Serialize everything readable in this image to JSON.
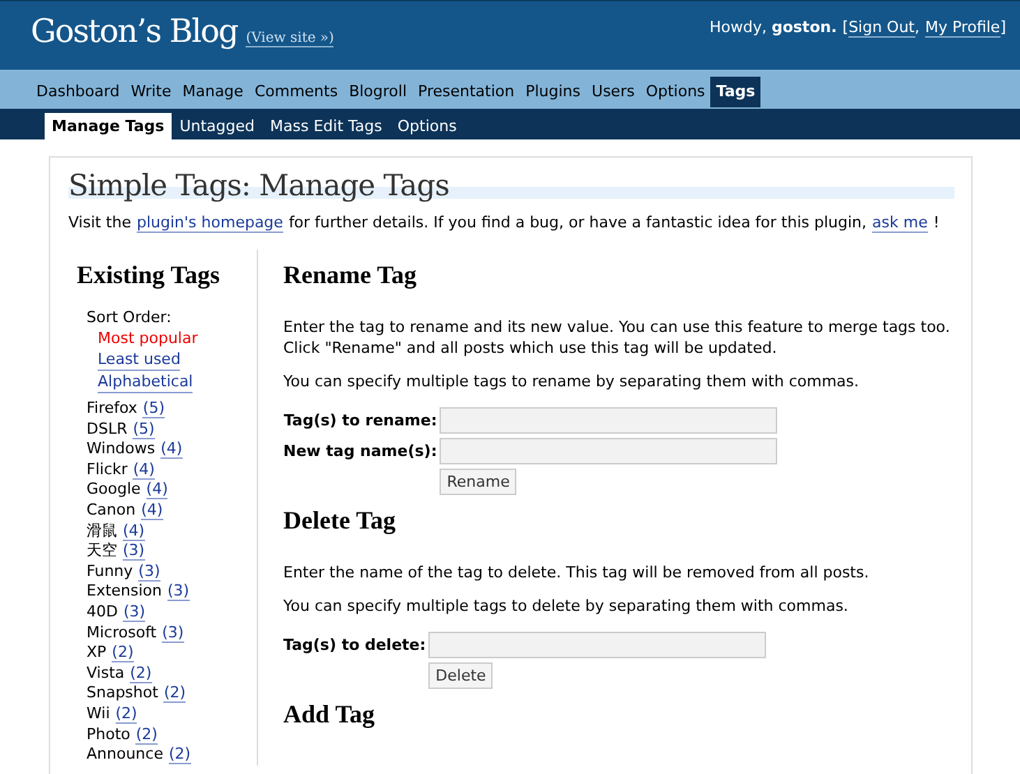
{
  "header": {
    "blog_title": "Goston’s Blog",
    "view_site": "(View site »)",
    "greeting": "Howdy,",
    "user": "goston.",
    "open_bracket": "[",
    "sign_out": "Sign Out",
    "separator": ",",
    "profile": "My Profile",
    "close_bracket": "]"
  },
  "nav": [
    {
      "label": "Dashboard",
      "selected": false
    },
    {
      "label": "Write",
      "selected": false
    },
    {
      "label": "Manage",
      "selected": false
    },
    {
      "label": "Comments",
      "selected": false
    },
    {
      "label": "Blogroll",
      "selected": false
    },
    {
      "label": "Presentation",
      "selected": false
    },
    {
      "label": "Plugins",
      "selected": false
    },
    {
      "label": "Users",
      "selected": false
    },
    {
      "label": "Options",
      "selected": false
    },
    {
      "label": "Tags",
      "selected": true
    }
  ],
  "subnav": [
    {
      "label": "Manage Tags",
      "selected": true
    },
    {
      "label": "Untagged",
      "selected": false
    },
    {
      "label": "Mass Edit Tags",
      "selected": false
    },
    {
      "label": "Options",
      "selected": false
    }
  ],
  "page_title": "Simple Tags: Manage Tags",
  "intro": {
    "before": "Visit the",
    "link1": "plugin's homepage",
    "middle": "for further details. If you find a bug, or have a fantastic idea for this plugin,",
    "link2": "ask me",
    "after": "!"
  },
  "existing_tags": {
    "title": "Existing Tags",
    "sort_label": "Sort Order:",
    "sort_options": [
      {
        "label": "Most popular",
        "selected": true
      },
      {
        "label": "Least used",
        "selected": false
      },
      {
        "label": "Alphabetical",
        "selected": false
      }
    ],
    "tags": [
      {
        "name": "Firefox",
        "count": "(5)"
      },
      {
        "name": "DSLR",
        "count": "(5)"
      },
      {
        "name": "Windows",
        "count": "(4)"
      },
      {
        "name": "Flickr",
        "count": "(4)"
      },
      {
        "name": "Google",
        "count": "(4)"
      },
      {
        "name": "Canon",
        "count": "(4)"
      },
      {
        "name": "滑鼠",
        "count": "(4)"
      },
      {
        "name": "天空",
        "count": "(3)"
      },
      {
        "name": "Funny",
        "count": "(3)"
      },
      {
        "name": "Extension",
        "count": "(3)"
      },
      {
        "name": "40D",
        "count": "(3)"
      },
      {
        "name": "Microsoft",
        "count": "(3)"
      },
      {
        "name": "XP",
        "count": "(2)"
      },
      {
        "name": "Vista",
        "count": "(2)"
      },
      {
        "name": "Snapshot",
        "count": "(2)"
      },
      {
        "name": "Wii",
        "count": "(2)"
      },
      {
        "name": "Photo",
        "count": "(2)"
      },
      {
        "name": "Announce",
        "count": "(2)"
      }
    ]
  },
  "sections": [
    {
      "title": "Rename Tag",
      "paragraphs": [
        "Enter the tag to rename and its new value. You can use this feature to merge tags too. Click \"Rename\" and all posts which use this tag will be updated.",
        "You can specify multiple tags to rename by separating them with commas."
      ],
      "fields": [
        "Tag(s) to rename:",
        "New tag name(s):"
      ],
      "button": "Rename"
    },
    {
      "title": "Delete Tag",
      "paragraphs": [
        "Enter the name of the tag to delete. This tag will be removed from all posts.",
        "You can specify multiple tags to delete by separating them with commas."
      ],
      "fields": [
        "Tag(s) to delete:"
      ],
      "button": "Delete"
    },
    {
      "title": "Add Tag"
    }
  ]
}
